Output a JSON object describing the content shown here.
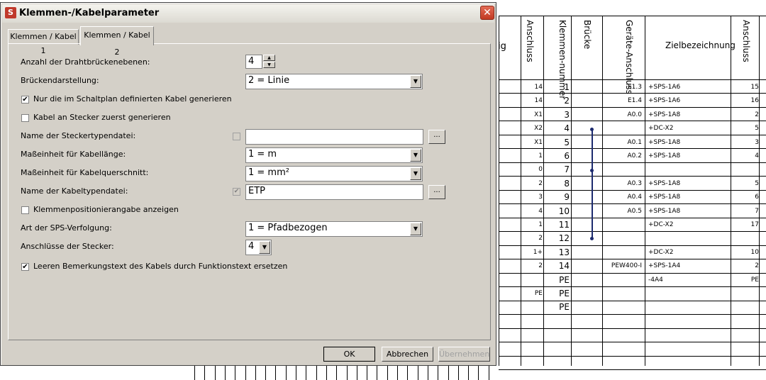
{
  "dialog": {
    "title": "Klemmen-/Kabelparameter",
    "close_glyph": "✕",
    "app_icon_glyph": "S",
    "tabs": [
      {
        "label": "Klemmen / Kabel 1"
      },
      {
        "label": "Klemmen / Kabel 2"
      }
    ],
    "fields": {
      "bridge_levels": {
        "label": "Anzahl der Drahtbrückenebenen:",
        "value": "4"
      },
      "bridge_display": {
        "label": "Brückendarstellung:",
        "value": "2 = Linie"
      },
      "only_defined_cables": {
        "label": "Nur die im Schaltplan definierten Kabel generieren",
        "checked": true
      },
      "cable_plug_first": {
        "label": "Kabel an Stecker zuerst generieren",
        "checked": false
      },
      "plug_type_file": {
        "label": "Name der Steckertypendatei:",
        "value": "",
        "checked": false
      },
      "cable_length_unit": {
        "label": "Maßeinheit für Kabellänge:",
        "value": "1 = m"
      },
      "cable_cross_unit": {
        "label": "Maßeinheit für Kabelquerschnitt:",
        "value": "1 = mm²"
      },
      "cable_type_file": {
        "label": "Name der Kabeltypendatei:",
        "value": "ETP",
        "checked": true
      },
      "terminal_position": {
        "label": "Klemmenpositionierangabe anzeigen",
        "checked": false
      },
      "sps_tracking": {
        "label": "Art der SPS-Verfolgung:",
        "value": "1 = Pfadbezogen"
      },
      "plug_connections": {
        "label": "Anschlüsse der Stecker:",
        "value": "4"
      },
      "replace_remark": {
        "label": "Leeren Bemerkungstext des Kabels durch Funktionstext ersetzen",
        "checked": true
      }
    },
    "browse_label": "...",
    "buttons": {
      "ok": "OK",
      "cancel": "Abbrechen",
      "apply": "Übernehmen"
    }
  },
  "background": {
    "partial_text": "ig",
    "headers": [
      "Anschluss",
      "Klemmen-nummer",
      "Brücke",
      "Geräte-Anschluss",
      "Zielbezeichnung",
      "Anschluss"
    ],
    "rows": [
      {
        "ans": "14",
        "num": "1",
        "ger": "E1.3",
        "ziel": "+SPS-1A6",
        "ans2": "15"
      },
      {
        "ans": "14",
        "num": "2",
        "ger": "E1.4",
        "ziel": "+SPS-1A6",
        "ans2": "16"
      },
      {
        "ans": "X1",
        "num": "3",
        "ger": "A0.0",
        "ziel": "+SPS-1A8",
        "ans2": "2"
      },
      {
        "ans": "X2",
        "num": "4",
        "ger": "",
        "ziel": "+DC-X2",
        "ans2": "5"
      },
      {
        "ans": "X1",
        "num": "5",
        "ger": "A0.1",
        "ziel": "+SPS-1A8",
        "ans2": "3"
      },
      {
        "ans": "1",
        "num": "6",
        "ger": "A0.2",
        "ziel": "+SPS-1A8",
        "ans2": "4"
      },
      {
        "ans": "0",
        "num": "7",
        "ger": "",
        "ziel": "",
        "ans2": ""
      },
      {
        "ans": "2",
        "num": "8",
        "ger": "A0.3",
        "ziel": "+SPS-1A8",
        "ans2": "5"
      },
      {
        "ans": "3",
        "num": "9",
        "ger": "A0.4",
        "ziel": "+SPS-1A8",
        "ans2": "6"
      },
      {
        "ans": "4",
        "num": "10",
        "ger": "A0.5",
        "ziel": "+SPS-1A8",
        "ans2": "7"
      },
      {
        "ans": "1",
        "num": "11",
        "ger": "",
        "ziel": "+DC-X2",
        "ans2": "17"
      },
      {
        "ans": "2",
        "num": "12",
        "ger": "",
        "ziel": "",
        "ans2": ""
      },
      {
        "ans": "1+",
        "num": "13",
        "ger": "",
        "ziel": "+DC-X2",
        "ans2": "10"
      },
      {
        "ans": "2",
        "num": "14",
        "ger": "PEW400-I",
        "ziel": "+SPS-1A4",
        "ans2": "2"
      },
      {
        "ans": "",
        "num": "PE",
        "ger": "",
        "ziel": "-4A4",
        "ans2": "PE"
      },
      {
        "ans": "PE",
        "num": "PE",
        "ger": "",
        "ziel": "",
        "ans2": ""
      },
      {
        "ans": "",
        "num": "PE",
        "ger": "",
        "ziel": "",
        "ans2": ""
      }
    ]
  }
}
